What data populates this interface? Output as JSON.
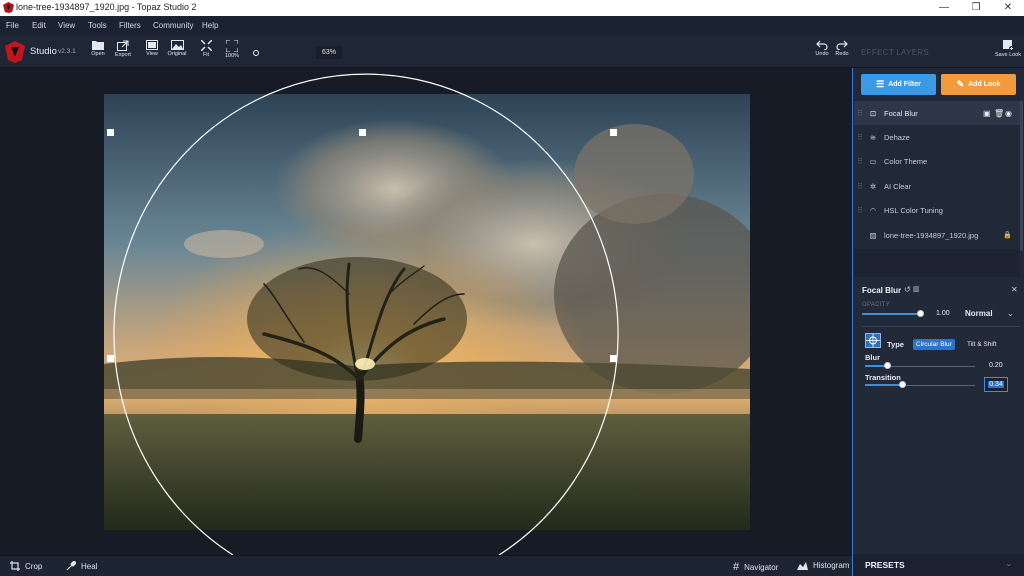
{
  "window": {
    "title": "lone-tree-1934897_1920.jpg - Topaz Studio 2",
    "minimize": "—",
    "maximize": "❐",
    "close": "✕"
  },
  "menu": [
    "File",
    "Edit",
    "View",
    "Tools",
    "Filters",
    "Community",
    "Help"
  ],
  "toolbar": {
    "studio_label": "Studio",
    "version": "v2.3.1",
    "buttons": [
      {
        "label": "Open",
        "icon": "folder-icon"
      },
      {
        "label": "Export",
        "icon": "export-icon"
      },
      {
        "label": "View",
        "icon": "view-icon"
      },
      {
        "label": "Original",
        "icon": "image-icon"
      },
      {
        "label": "Fit",
        "icon": "fit-icon"
      },
      {
        "label": "100%",
        "icon": "actual-size-icon"
      }
    ],
    "zoom_value": "63%",
    "undo_label": "Undo",
    "redo_label": "Redo",
    "effect_layers_label": "EFFECT LAYERS",
    "save_look_label": "Save Look"
  },
  "panel": {
    "add_filter_label": "Add Filter",
    "add_look_label": "Add Look",
    "add_filter_color": "#3b9ae6",
    "add_look_color": "#f39a3c",
    "layers": [
      {
        "name": "Focal Blur",
        "icon": "focal-blur-icon",
        "selected": true
      },
      {
        "name": "Dehaze",
        "icon": "dehaze-icon"
      },
      {
        "name": "Color Theme",
        "icon": "color-theme-icon"
      },
      {
        "name": "AI Clear",
        "icon": "ai-clear-icon"
      },
      {
        "name": "HSL Color Tuning",
        "icon": "hsl-icon"
      },
      {
        "name": "lone-tree-1934897_1920.jpg",
        "icon": "image-icon",
        "locked": true
      }
    ],
    "filter_title": "Focal Blur",
    "opacity_label": "OPACITY",
    "opacity_value": "1.00",
    "opacity_fraction": 1.0,
    "blend_mode": "Normal",
    "type_label": "Type",
    "type_option_active": "Circular Blur",
    "type_option_inactive": "Tilt & Shift",
    "blur_label": "Blur",
    "blur_value": "0.20",
    "blur_fraction": 0.2,
    "transition_label": "Transition",
    "transition_value": "0.34",
    "transition_fraction": 0.34,
    "presets_label": "PRESETS"
  },
  "bottombar": {
    "crop_label": "Crop",
    "heal_label": "Heal",
    "navigator_label": "Navigator",
    "histogram_label": "Histogram"
  }
}
